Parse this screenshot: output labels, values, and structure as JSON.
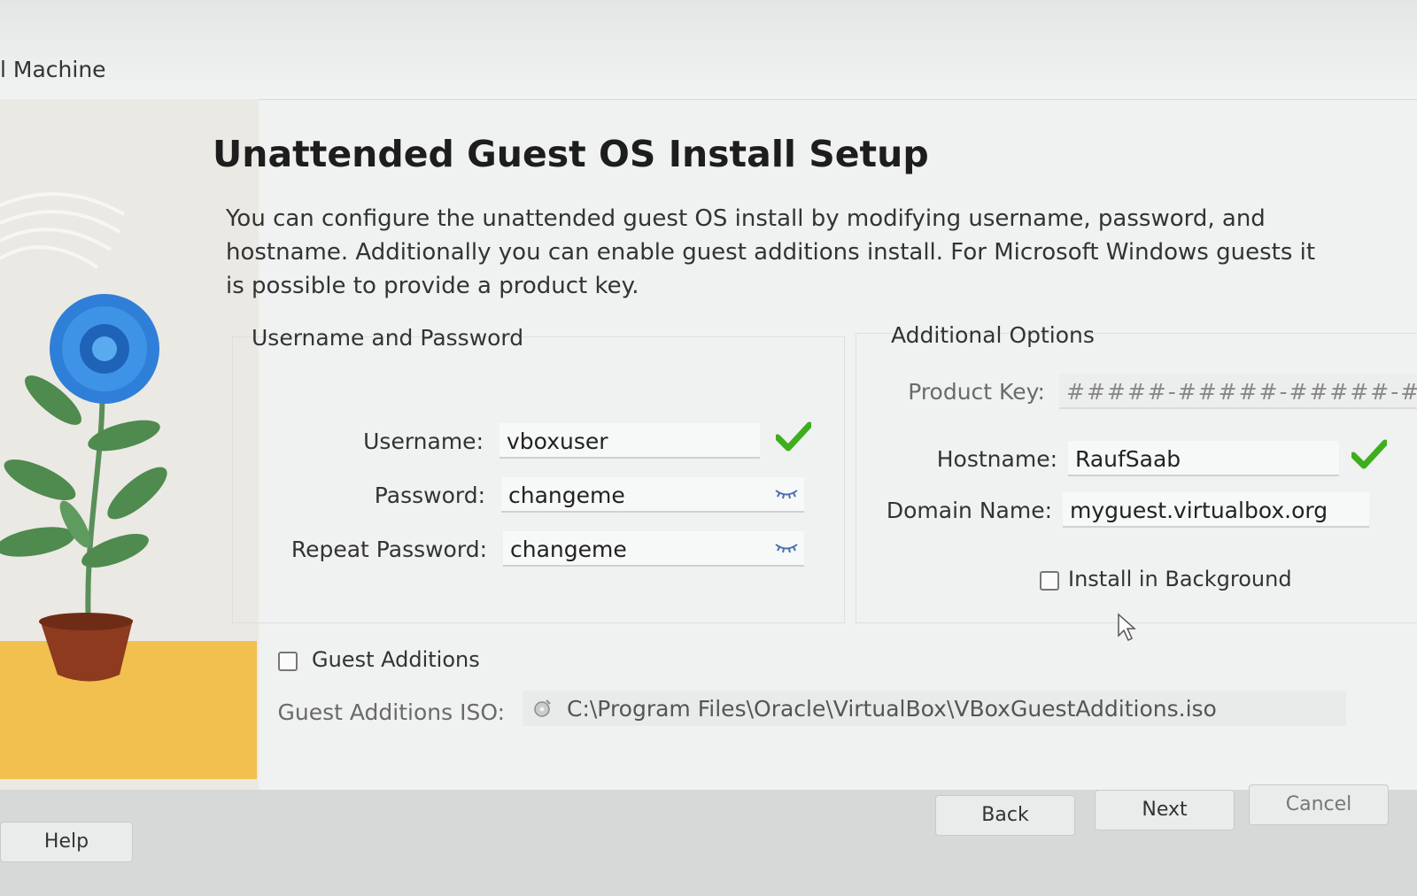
{
  "window": {
    "title": "l Machine"
  },
  "page": {
    "title": "Unattended Guest OS Install Setup",
    "description": "You can configure the unattended guest OS install by modifying username, password, and hostname. Additionally you can enable guest additions install. For Microsoft Windows guests it is possible to provide a product key."
  },
  "credentials": {
    "group_title": "Username and Password",
    "username_label": "Username:",
    "username_value": "vboxuser",
    "password_label": "Password:",
    "password_value": "changeme",
    "repeat_label": "Repeat Password:",
    "repeat_value": "changeme"
  },
  "options": {
    "group_title": "Additional Options",
    "product_key_label": "Product Key:",
    "product_key_placeholder": "#####-#####-#####-####",
    "hostname_label": "Hostname:",
    "hostname_value": "RaufSaab",
    "domain_label": "Domain Name:",
    "domain_value": "myguest.virtualbox.org",
    "background_label": "Install in Background",
    "background_checked": false
  },
  "guest_additions": {
    "label": "Guest Additions",
    "checked": false,
    "iso_label": "Guest Additions ISO:",
    "iso_path": "C:\\Program Files\\Oracle\\VirtualBox\\VBoxGuestAdditions.iso"
  },
  "buttons": {
    "help": "Help",
    "back": "Back",
    "next": "Next",
    "cancel": "Cancel"
  },
  "colors": {
    "valid_check": "#3fae1e",
    "eye_icon": "#4a6fb0",
    "flower": "#2f7fd8",
    "pot": "#8d3a1f",
    "side_ground": "#f1c04f"
  },
  "icons": [
    "checkmark-icon",
    "eye-icon",
    "disc-icon",
    "mouse-cursor-icon"
  ]
}
